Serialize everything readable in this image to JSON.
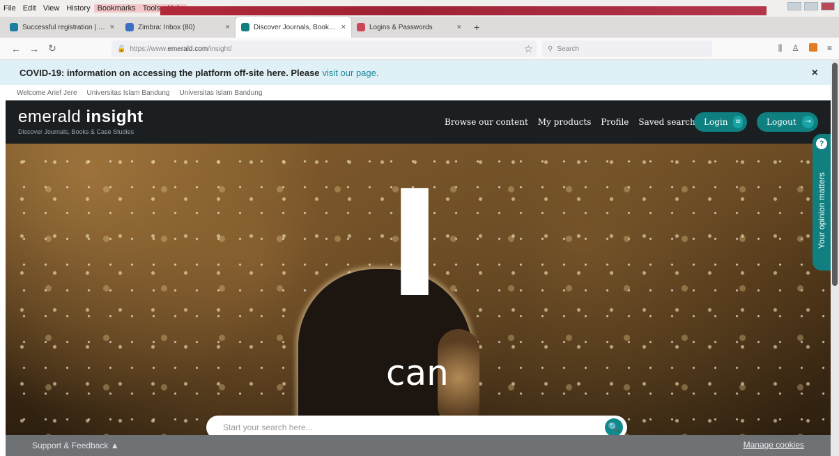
{
  "browser": {
    "menu": [
      "File",
      "Edit",
      "View",
      "History",
      "Bookmarks",
      "Tools",
      "Help"
    ],
    "tabs": [
      {
        "label": "Successful registration | Emer...",
        "favicon_color": "#1a7fa0"
      },
      {
        "label": "Zimbra: Inbox (80)",
        "favicon_color": "#3a6fc4"
      },
      {
        "label": "Discover Journals, Books & Ca...",
        "favicon_color": "#0f7f80"
      },
      {
        "label": "Logins & Passwords",
        "favicon_color": "#cc4455"
      }
    ],
    "new_tab_icon": "+",
    "url_prefix": "https://www.",
    "url_domain": "emerald.com",
    "url_path": "/insight/",
    "search_placeholder": "Search",
    "icons": {
      "back": "←",
      "forward": "→",
      "reload": "↻",
      "star": "☆",
      "search": "🔍",
      "library": "⫼",
      "account": "♙",
      "menu": "≡"
    }
  },
  "banner": {
    "text": "COVID-19: information on accessing the platform off-site here. Please",
    "link": "visit our page.",
    "close": "×"
  },
  "welcome": [
    "Welcome Arief Jere",
    "Universitas Islam Bandung",
    "Universitas Islam Bandung"
  ],
  "header": {
    "logo_light": "emerald",
    "logo_bold": "insight",
    "tagline": "Discover Journals, Books & Case Studies",
    "nav": [
      "Browse our content",
      "My products",
      "Profile",
      "Saved searches"
    ],
    "login": "Login",
    "logout": "Logout",
    "login_icon": "≡",
    "logout_icon": "⇥"
  },
  "hero": {
    "big": "I",
    "word": "can",
    "search_placeholder": "Start your search here...",
    "search_icon": "🔍"
  },
  "opinion": {
    "label": "Your opinion matters",
    "icon": "?"
  },
  "footer": {
    "support": "Support & Feedback",
    "support_icon": "▲",
    "cookies": "Manage cookies"
  }
}
